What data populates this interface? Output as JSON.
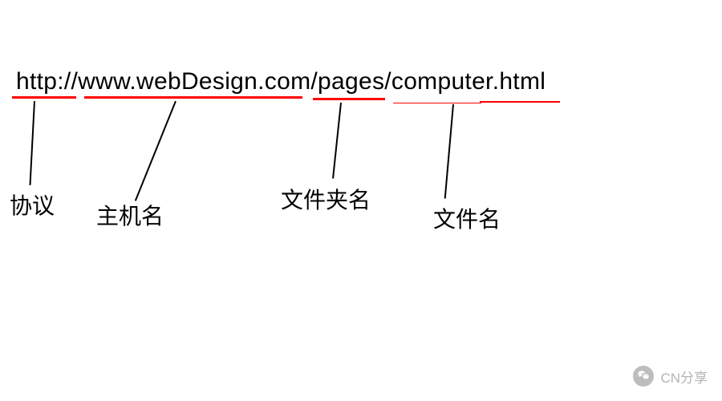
{
  "url": {
    "full": "http://www.webDesign.com/pages/computer.html",
    "parts": {
      "protocol": "http:",
      "separator1": "//",
      "host": "www.webDesign.com",
      "separator2": "/",
      "folder": "pages",
      "separator3": "/",
      "file": "computer.html"
    }
  },
  "labels": {
    "protocol": "协议",
    "host": "主机名",
    "folder": "文件夹名",
    "file": "文件名"
  },
  "watermark": {
    "text": "CN分享"
  }
}
